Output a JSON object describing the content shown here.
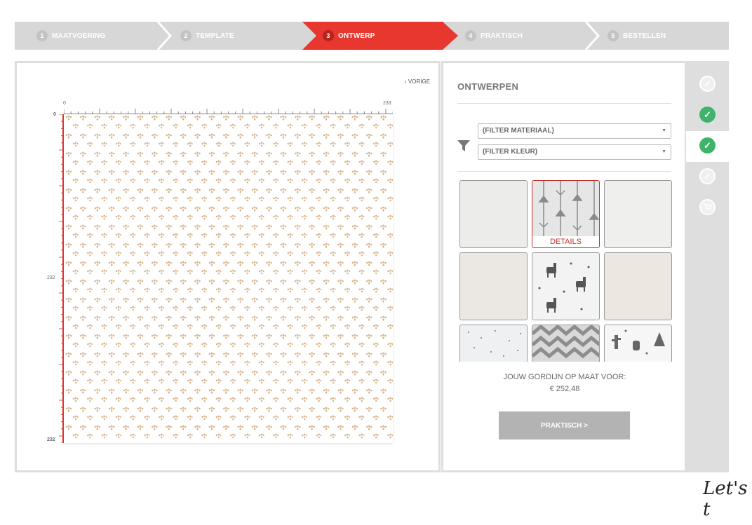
{
  "stepper": {
    "steps": [
      {
        "num": "1",
        "label": "MAATVOERING"
      },
      {
        "num": "2",
        "label": "TEMPLATE"
      },
      {
        "num": "3",
        "label": "ONTWERP"
      },
      {
        "num": "4",
        "label": "PRAKTISCH"
      },
      {
        "num": "5",
        "label": "BESTELLEN"
      }
    ],
    "active_index": 2,
    "active_color": "#e8372e"
  },
  "canvas": {
    "back_label": "VORIGE",
    "ruler": {
      "top_start": "0",
      "top_end": "233",
      "left_start": "0",
      "left_mid": "232",
      "left_end": "232"
    },
    "pattern_color": "#d8b48e"
  },
  "designs": {
    "title": "ONTWERPEN",
    "filter_material": "(FILTER MATERIAAL)",
    "filter_color": "(FILTER KLEUR)",
    "tiles": [
      {
        "name": "plain-off-white",
        "kind": "plain"
      },
      {
        "name": "arrows-grey",
        "kind": "arrows",
        "selected": true,
        "details_label": "DETAILS"
      },
      {
        "name": "textured-white",
        "kind": "plain"
      },
      {
        "name": "linen-beige",
        "kind": "plain"
      },
      {
        "name": "llamas-cactus",
        "kind": "pattern"
      },
      {
        "name": "cream",
        "kind": "plain"
      },
      {
        "name": "dots-grey",
        "kind": "dots"
      },
      {
        "name": "zigzag-grey",
        "kind": "zigzag"
      },
      {
        "name": "cactus-teepee",
        "kind": "pattern"
      }
    ]
  },
  "summary": {
    "price_label": "JOUW GORDIJN OP MAAT VOOR:",
    "price_value": "€ 252,48",
    "next_button": "PRAKTISCH >"
  },
  "side_nav": {
    "icons": [
      "check-icon",
      "check-icon",
      "check-icon",
      "check-icon",
      "cart-icon"
    ],
    "done_color": "#3fb36b"
  },
  "footer": {
    "script_text": "Let's t"
  }
}
